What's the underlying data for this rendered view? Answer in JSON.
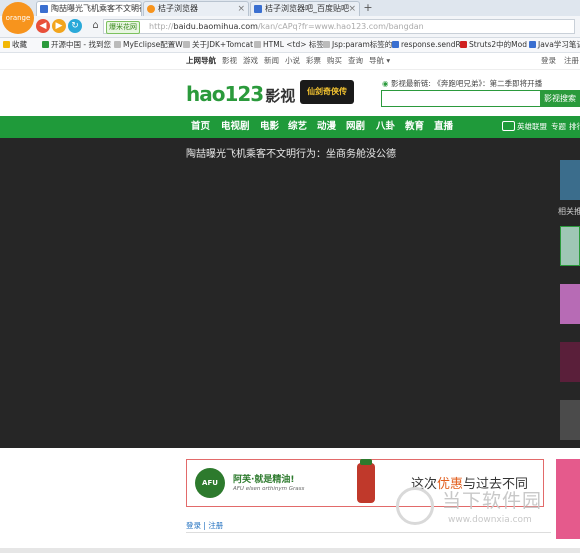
{
  "browser": {
    "logo_text": "orange",
    "tabs": [
      {
        "label": "陶喆曝光飞机乘客不文明行为",
        "active": true,
        "icon_color": "#3a6fd0"
      },
      {
        "label": "桔子浏览器",
        "active": false,
        "icon_color": "#f7941d"
      },
      {
        "label": "桔子浏览器吧_百度贴吧",
        "active": false,
        "icon_color": "#3a6fd0"
      }
    ],
    "new_tab": "+",
    "tab_close": "×",
    "secure_label": "爆米花网",
    "url_prefix": "http://",
    "url_domain": "baidu.baomihua.com",
    "url_path": "/kan/cAPq?fr=www.hao123.com/bangdan",
    "bookmarks": [
      {
        "label": "收藏",
        "color": "#f2b705"
      },
      {
        "label": "开源中国 - 找到您",
        "color": "#2b9a3c"
      },
      {
        "label": "MyEclipse配置W",
        "color": "#888888"
      },
      {
        "label": "关于JDK+Tomcat",
        "color": "#888888"
      },
      {
        "label": "HTML <td> 标签",
        "color": "#888888"
      },
      {
        "label": "Jsp:param标签的",
        "color": "#888888"
      },
      {
        "label": "response.sendR",
        "color": "#3a6fd0"
      },
      {
        "label": "Struts2中的Mod",
        "color": "#d02020"
      },
      {
        "label": "Java学习笔记(",
        "color": "#3a6fd0"
      }
    ]
  },
  "site": {
    "top_links": [
      "上网导航",
      "影视",
      "游戏",
      "新闻",
      "小说",
      "彩票",
      "购买",
      "查询",
      "导航 ▾"
    ],
    "top_right": [
      "登录",
      "注册"
    ],
    "brand": "hao123",
    "brand_suffix": "影视",
    "promo": "仙剑奇侠传",
    "latest_label": "影视最新链:",
    "latest_text": "《奔跑吧兄弟》：第二季即将开播",
    "search_button": "影视搜索",
    "nav": [
      "首页",
      "电视剧",
      "电影",
      "综艺",
      "动漫",
      "网剧",
      "八卦",
      "教育",
      "直播"
    ],
    "nav_right": [
      "英雄联盟",
      "专题",
      "排行"
    ],
    "video_title": "陶喆曝光飞机乘客不文明行为：坐商务舱没公德",
    "related_label": "相关推",
    "ad_brand": "AFU",
    "ad_slogan": "阿芙·就是精油!",
    "ad_sub": "AFU elsen orthinym Grass",
    "ad_text_pre": "这次",
    "ad_text_em": "优惠",
    "ad_text_post": "与过去不同",
    "login_link": "登录",
    "separator": "|",
    "register_link": "注册"
  },
  "watermark": {
    "title": "当下软件园",
    "url": "www.downxia.com"
  }
}
